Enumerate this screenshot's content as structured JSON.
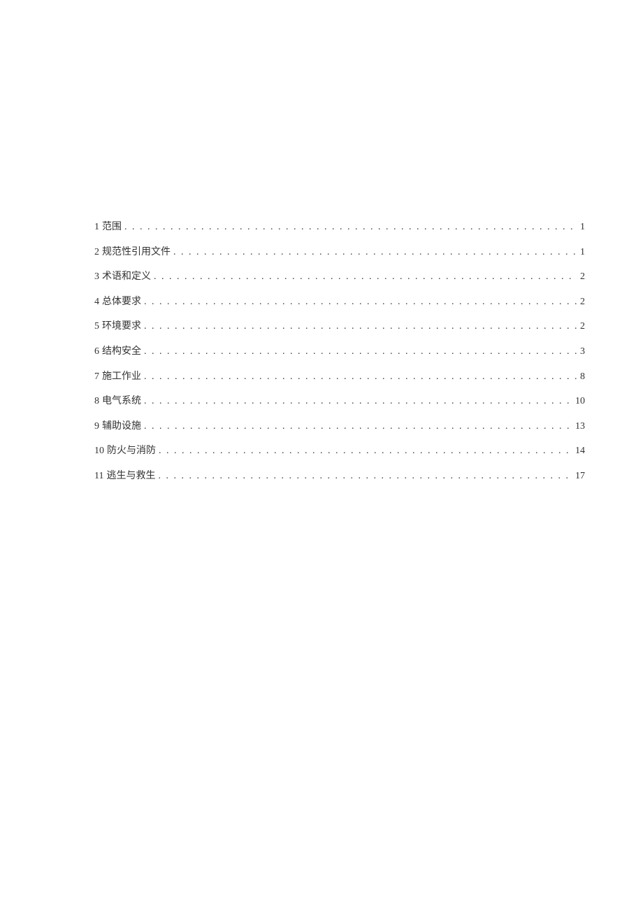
{
  "toc": {
    "entries": [
      {
        "number": "1",
        "title": "范围",
        "page": "1"
      },
      {
        "number": "2",
        "title": "规范性引用文件",
        "page": "1"
      },
      {
        "number": "3",
        "title": "术语和定义",
        "page": "2"
      },
      {
        "number": "4",
        "title": "总体要求",
        "page": "2"
      },
      {
        "number": "5",
        "title": "环境要求",
        "page": "2"
      },
      {
        "number": "6",
        "title": "结构安全",
        "page": "3"
      },
      {
        "number": "7",
        "title": "施工作业",
        "page": "8"
      },
      {
        "number": "8",
        "title": "电气系统",
        "page": "10"
      },
      {
        "number": "9",
        "title": "辅助设施",
        "page": "13"
      },
      {
        "number": "10",
        "title": "防火与消防",
        "page": "14"
      },
      {
        "number": "11",
        "title": "逃生与救生",
        "page": "17"
      }
    ]
  }
}
